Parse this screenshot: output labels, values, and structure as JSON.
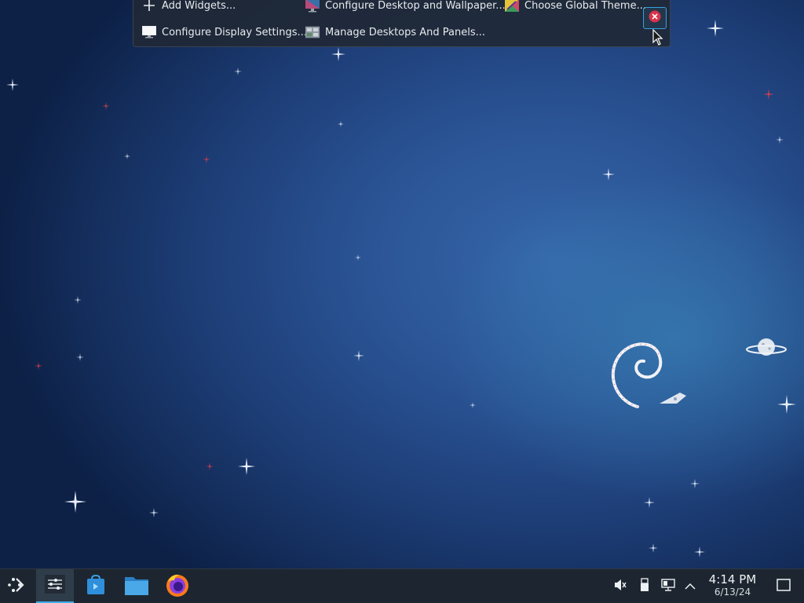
{
  "edit_toolbar": {
    "add_widgets": "Add Widgets...",
    "configure_desktop": "Configure Desktop and Wallpaper...",
    "global_theme": "Choose Global Theme...",
    "display_settings": "Configure Display Settings...",
    "manage_desktops": "Manage Desktops And Panels..."
  },
  "taskbar": {
    "time": "4:14 PM",
    "date": "6/13/24"
  },
  "colors": {
    "panel_bg": "#1d2630",
    "accent": "#3daee9",
    "close_red": "#d9334a"
  },
  "icons": [
    "plus-icon",
    "monitor-wallpaper-icon",
    "global-theme-icon",
    "display-icon",
    "desktops-panels-icon",
    "close-icon",
    "app-launcher-icon",
    "pager-icon",
    "discover-icon",
    "files-icon",
    "firefox-icon",
    "speaker-muted-icon",
    "usb-icon",
    "network-icon",
    "chevron-up-icon",
    "show-desktop-icon"
  ]
}
